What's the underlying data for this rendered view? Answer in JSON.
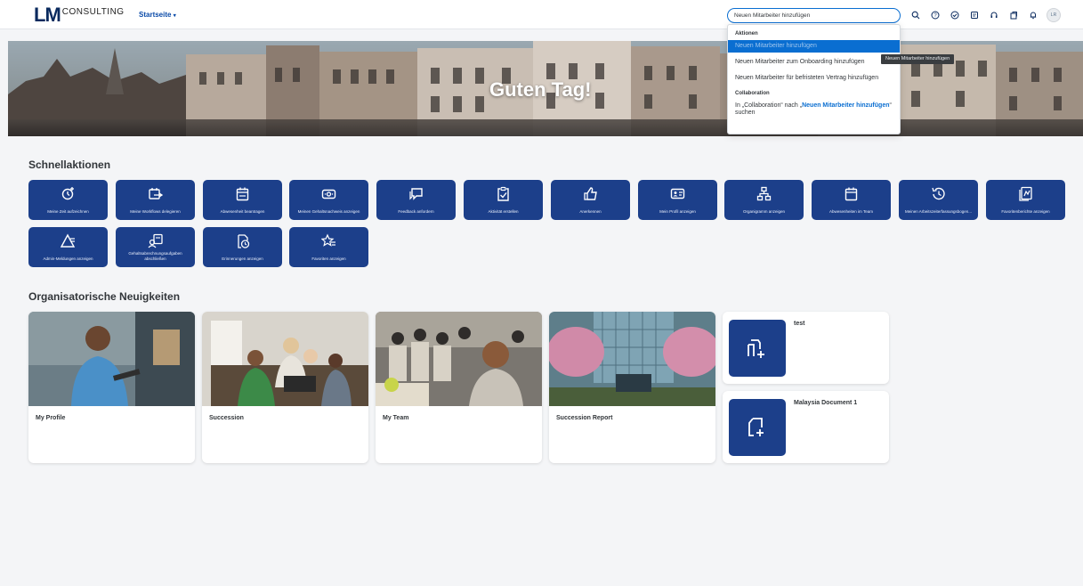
{
  "header": {
    "logo_mark": "LM",
    "logo_text": "CONSULTING",
    "home_menu": "Startseite",
    "search_value": "Neuen Mitarbeiter hinzufügen",
    "avatar_initials": "LR",
    "icons": [
      "search-icon",
      "help-icon",
      "check-circle-icon",
      "notes-icon",
      "headset-icon",
      "share-icon",
      "bell-icon"
    ]
  },
  "hero": {
    "greeting": "Guten Tag!"
  },
  "search_dropdown": {
    "section_actions": "Aktionen",
    "items": [
      "Neuen Mitarbeiter hinzufügen",
      "Neuen Mitarbeiter zum Onboarding hinzufügen",
      "Neuen Mitarbeiter für befristeten Vertrag hinzufügen"
    ],
    "section_collab": "Collaboration",
    "collab_prefix": "In „Collaboration“ nach „",
    "collab_highlight": "Neuen Mitarbeiter hinzufügen",
    "collab_suffix": "“ suchen",
    "tooltip": "Neuen Mitarbeiter hinzufügen"
  },
  "quick_actions": {
    "title": "Schnellaktionen",
    "tiles": [
      {
        "label": "Meine Zeit aufzeichnen",
        "icon": "clock-plus-icon"
      },
      {
        "label": "Meine Workflows delegieren",
        "icon": "calendar-arrow-icon"
      },
      {
        "label": "Abwesenheit beantragen",
        "icon": "calendar-request-icon"
      },
      {
        "label": "Meinen Gehaltsnachweis anzeigen",
        "icon": "payslip-icon"
      },
      {
        "label": "Feedback anfordern",
        "icon": "feedback-icon"
      },
      {
        "label": "Aktivität erstellen",
        "icon": "clipboard-check-icon"
      },
      {
        "label": "Anerkennen",
        "icon": "thumbs-up-icon"
      },
      {
        "label": "Mein Profil anzeigen",
        "icon": "id-card-icon"
      },
      {
        "label": "Organigramm anzeigen",
        "icon": "org-chart-icon"
      },
      {
        "label": "Abwesenheiten im Team",
        "icon": "calendar-team-icon"
      },
      {
        "label": "Meinen Arbeitszeiterfassungsbogen...",
        "icon": "history-icon"
      },
      {
        "label": "Favoritenberichte anzeigen",
        "icon": "favorite-reports-icon"
      },
      {
        "label": "Admin-Meldungen anzeigen",
        "icon": "admin-alert-icon"
      },
      {
        "label": "Gehaltsabrechnungsaufgaben abschließen",
        "icon": "payroll-task-icon"
      },
      {
        "label": "Erinnerungen anzeigen",
        "icon": "reminder-icon"
      },
      {
        "label": "Favoriten anzeigen",
        "icon": "star-list-icon"
      }
    ]
  },
  "org_news": {
    "title": "Organisatorische Neuigkeiten",
    "tiles": [
      {
        "title": "My Profile"
      },
      {
        "title": "Succession"
      },
      {
        "title": "My Team"
      },
      {
        "title": "Succession Report"
      }
    ],
    "documents": [
      {
        "title": "test"
      },
      {
        "title": "Malaysia Document 1"
      }
    ]
  },
  "colors": {
    "tile_blue": "#1c3f8a",
    "accent": "#0a6ed1"
  }
}
